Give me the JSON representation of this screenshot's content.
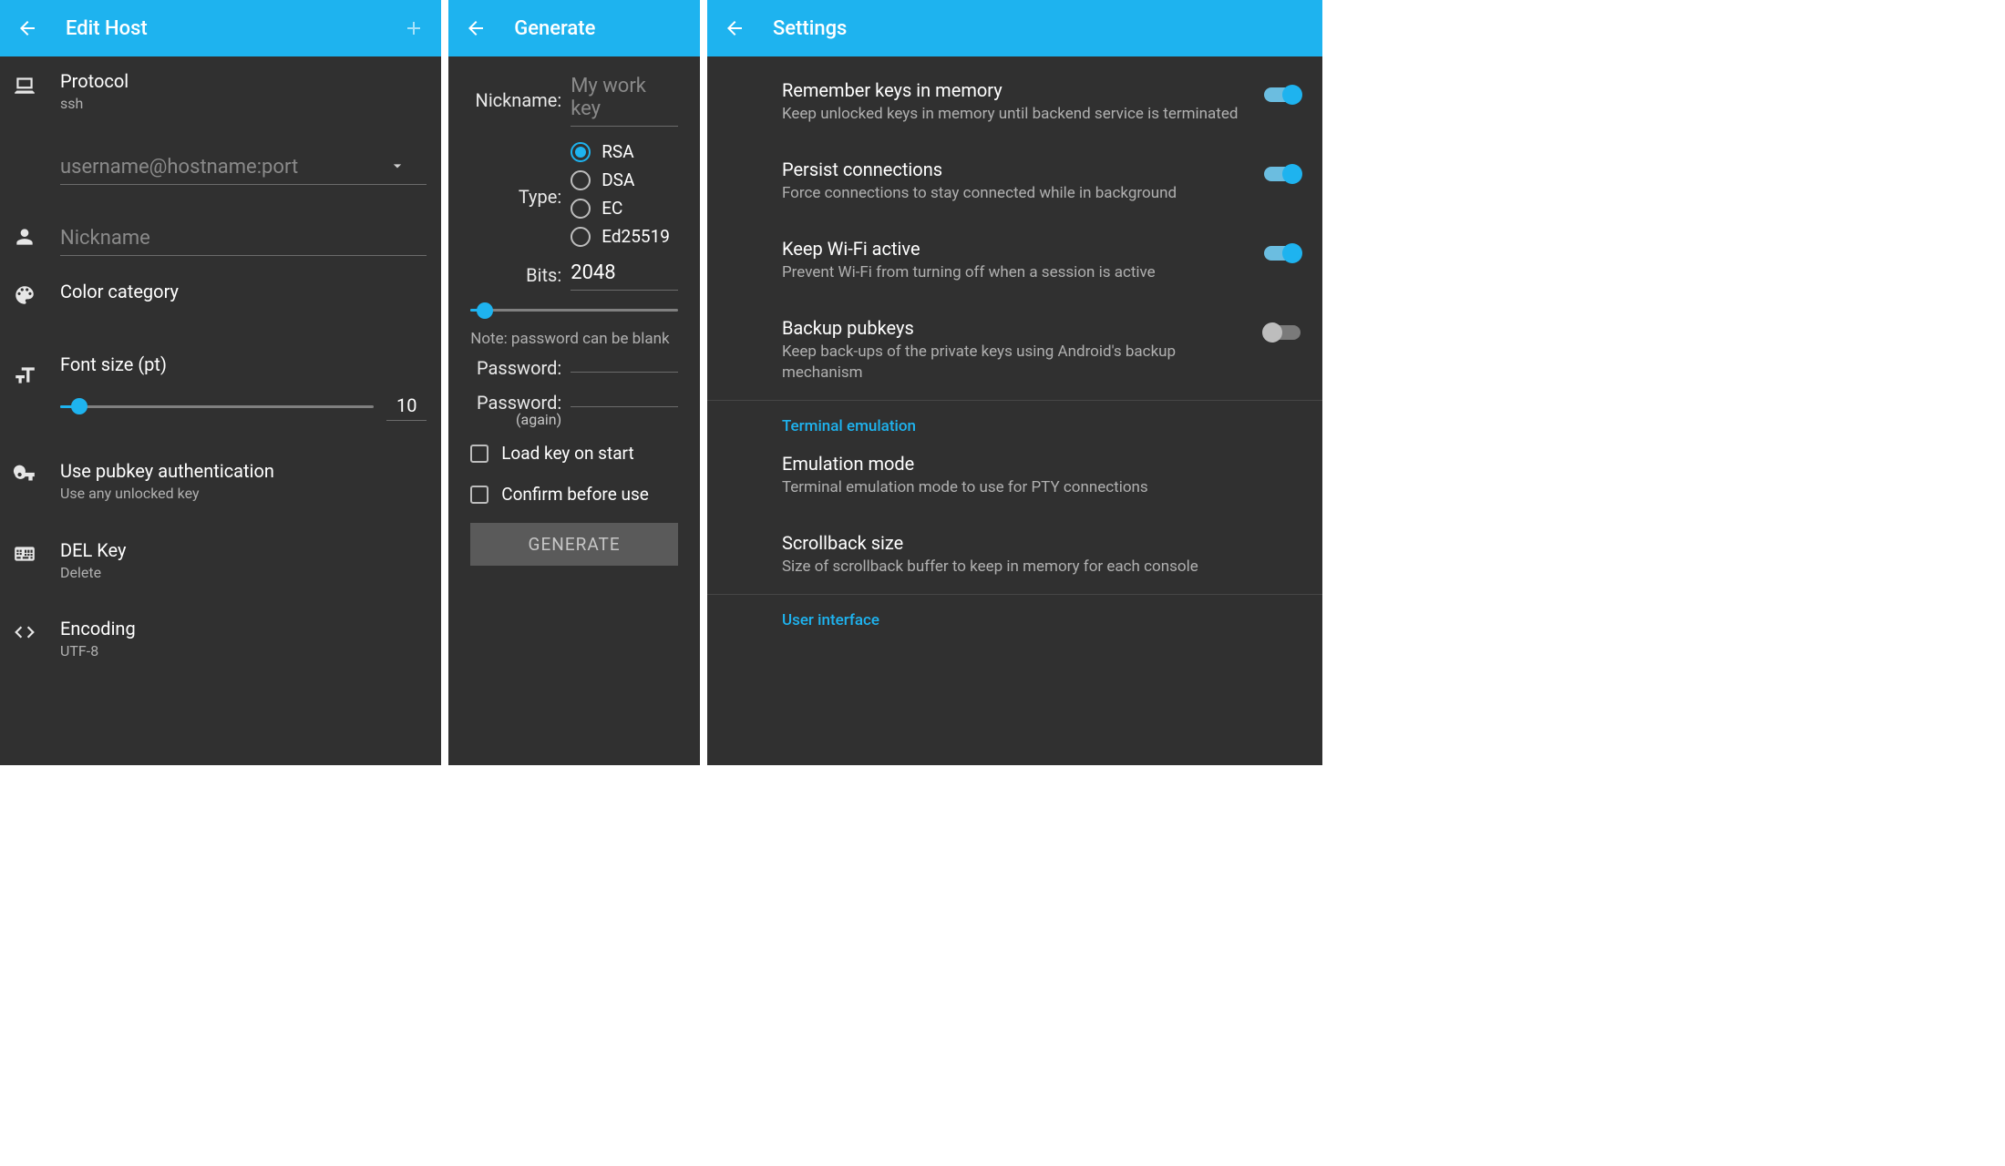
{
  "panel1": {
    "title": "Edit Host",
    "protocol": {
      "label": "Protocol",
      "value": "ssh"
    },
    "connection_placeholder": "username@hostname:port",
    "nickname_placeholder": "Nickname",
    "color_category": "Color category",
    "font_size": {
      "label": "Font size (pt)",
      "value": "10",
      "pct": 6
    },
    "pubkey": {
      "label": "Use pubkey authentication",
      "sub": "Use any unlocked key"
    },
    "del": {
      "label": "DEL Key",
      "sub": "Delete"
    },
    "encoding": {
      "label": "Encoding",
      "sub": "UTF-8"
    }
  },
  "panel2": {
    "title": "Generate",
    "nickname_label": "Nickname:",
    "nickname_placeholder": "My work key",
    "type_label": "Type:",
    "types": [
      "RSA",
      "DSA",
      "EC",
      "Ed25519"
    ],
    "type_selected": "RSA",
    "bits_label": "Bits:",
    "bits_value": "2048",
    "bits_slider_pct": 7,
    "note": "Note: password can be blank",
    "password_label": "Password:",
    "password2_label": "Password:",
    "password2_sub": "(again)",
    "cb_load": "Load key on start",
    "cb_confirm": "Confirm before use",
    "generate_btn": "GENERATE"
  },
  "panel3": {
    "title": "Settings",
    "items": [
      {
        "title": "Remember keys in memory",
        "sub": "Keep unlocked keys in memory until backend service is terminated",
        "toggle": true
      },
      {
        "title": "Persist connections",
        "sub": "Force connections to stay connected while in background",
        "toggle": true
      },
      {
        "title": "Keep Wi-Fi active",
        "sub": "Prevent Wi-Fi from turning off when a session is active",
        "toggle": true
      },
      {
        "title": "Backup pubkeys",
        "sub": "Keep back-ups of the private keys using Android's backup mechanism",
        "toggle": false
      }
    ],
    "section1": "Terminal emulation",
    "emu": {
      "title": "Emulation mode",
      "sub": "Terminal emulation mode to use for PTY connections"
    },
    "scrollback": {
      "title": "Scrollback size",
      "sub": "Size of scrollback buffer to keep in memory for each console"
    },
    "section2": "User interface"
  }
}
